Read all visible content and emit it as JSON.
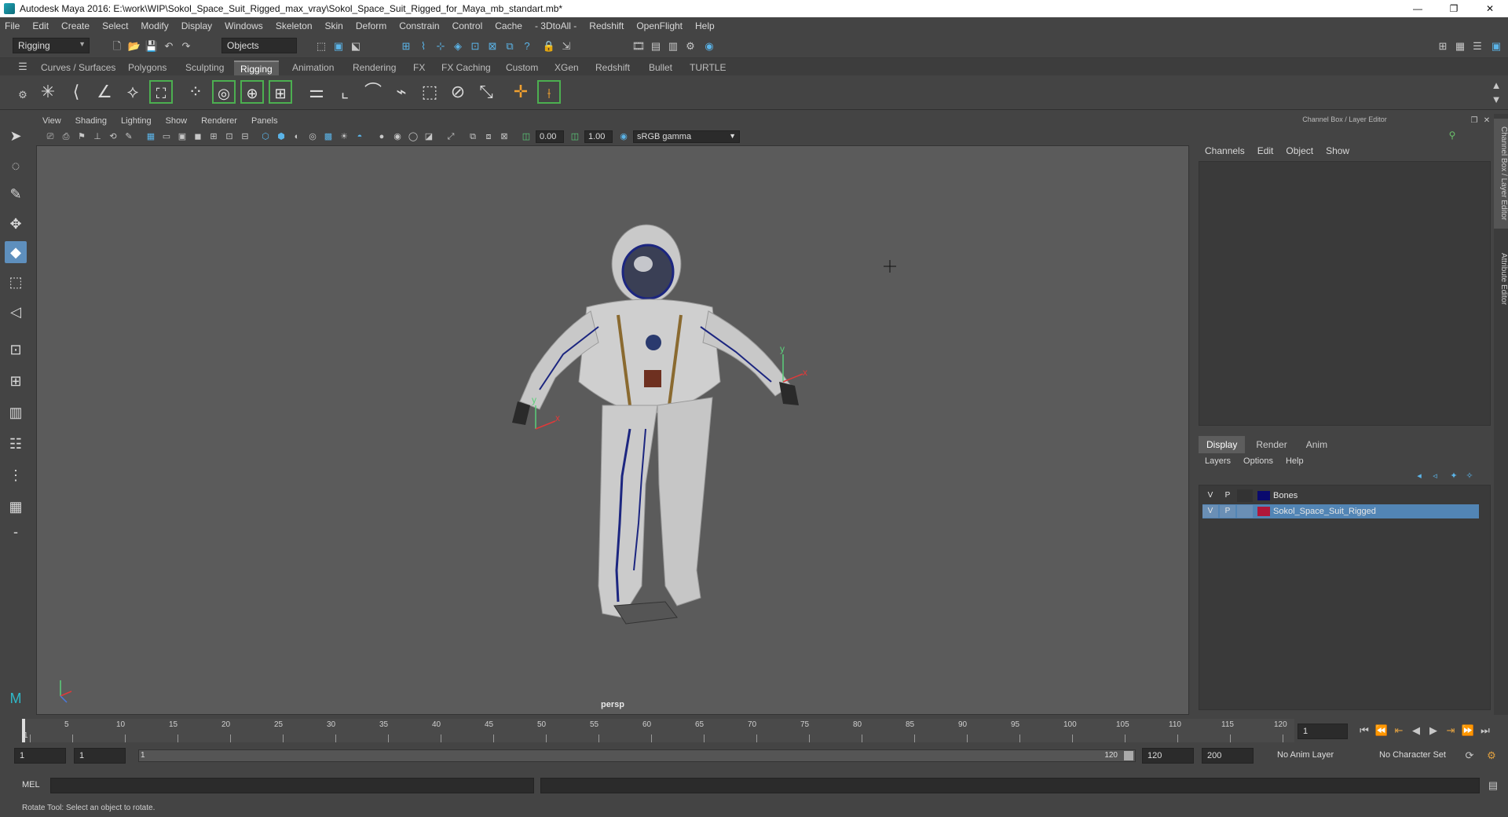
{
  "window": {
    "title": "Autodesk Maya 2016: E:\\work\\WIP\\Sokol_Space_Suit_Rigged_max_vray\\Sokol_Space_Suit_Rigged_for_Maya_mb_standart.mb*",
    "minimize": "—",
    "restore": "❐",
    "close": "✕"
  },
  "menubar": [
    "File",
    "Edit",
    "Create",
    "Select",
    "Modify",
    "Display",
    "Windows",
    "Skeleton",
    "Skin",
    "Deform",
    "Constrain",
    "Control",
    "Cache",
    "- 3DtoAll -",
    "Redshift",
    "OpenFlight",
    "Help"
  ],
  "statusline": {
    "menuset": "Rigging",
    "selection_mode": "Objects"
  },
  "shelf": {
    "tabs": [
      "Curves / Surfaces",
      "Polygons",
      "Sculpting",
      "Rigging",
      "Animation",
      "Rendering",
      "FX",
      "FX Caching",
      "Custom",
      "XGen",
      "Redshift",
      "Bullet",
      "TURTLE"
    ],
    "active_tab": "Rigging"
  },
  "panel": {
    "menu": [
      "View",
      "Shading",
      "Lighting",
      "Show",
      "Renderer",
      "Panels"
    ],
    "exposure": "0.00",
    "gamma": "1.00",
    "colorspace": "sRGB gamma",
    "camera": "persp"
  },
  "channel_box": {
    "header": "Channel Box / Layer Editor",
    "menu": [
      "Channels",
      "Edit",
      "Object",
      "Show"
    ],
    "side_tabs": [
      "Channel Box / Layer Editor",
      "Attribute Editor"
    ]
  },
  "layer_editor": {
    "tabs": [
      "Display",
      "Render",
      "Anim"
    ],
    "active_tab": "Display",
    "menu": [
      "Layers",
      "Options",
      "Help"
    ],
    "layers": [
      {
        "v": "V",
        "p": "P",
        "color": "#0a0a6e",
        "name": "Bones",
        "selected": false
      },
      {
        "v": "V",
        "p": "P",
        "color": "#b0173a",
        "name": "Sokol_Space_Suit_Rigged",
        "selected": true
      }
    ]
  },
  "timeline": {
    "ticks": [
      "1",
      "5",
      "10",
      "15",
      "20",
      "25",
      "30",
      "35",
      "40",
      "45",
      "50",
      "55",
      "60",
      "65",
      "70",
      "75",
      "80",
      "85",
      "90",
      "95",
      "100",
      "105",
      "110",
      "115",
      "120"
    ],
    "current_frame": "1"
  },
  "range": {
    "start": "1",
    "playback_start": "1",
    "slider_start": "1",
    "slider_end": "120",
    "playback_end": "120",
    "end": "200",
    "anim_layer": "No Anim Layer",
    "character_set": "No Character Set"
  },
  "cmdline": {
    "label": "MEL"
  },
  "helpline": {
    "text": "Rotate Tool: Select an object to rotate."
  }
}
